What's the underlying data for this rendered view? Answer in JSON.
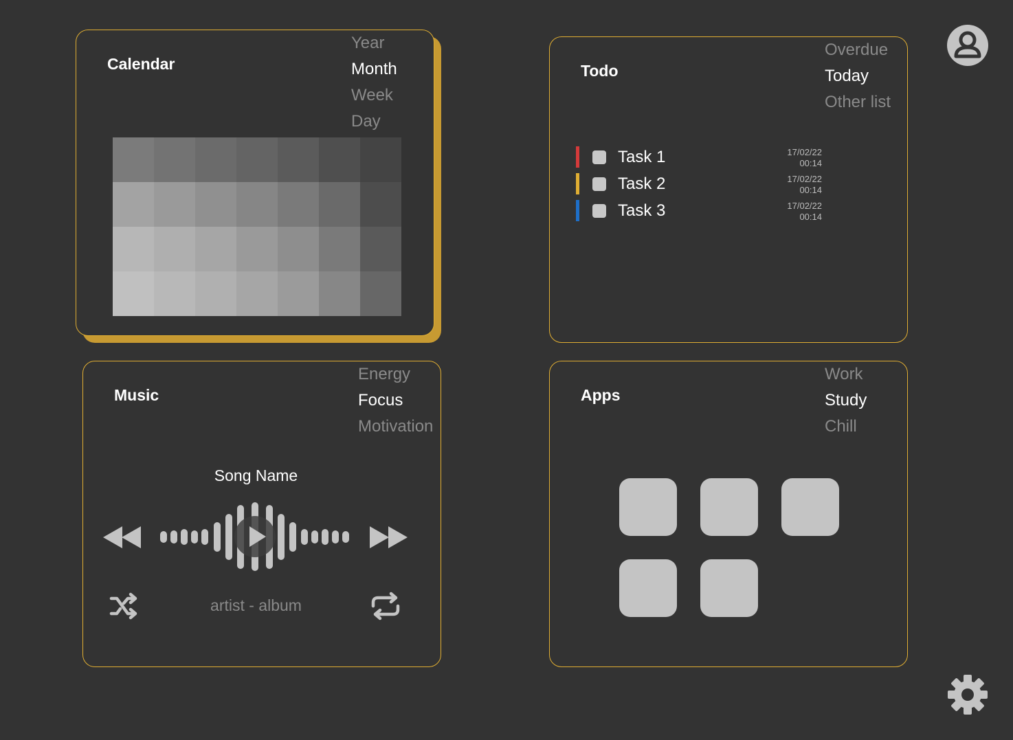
{
  "calendar": {
    "title": "Calendar",
    "views": [
      "Year",
      "Month",
      "Week",
      "Day"
    ],
    "active_view": "Month",
    "heatmap": [
      [
        "#7b7b7b",
        "#737373",
        "#6b6b6b",
        "#646464",
        "#5b5b5b",
        "#4f4f4f",
        "#444444"
      ],
      [
        "#a3a3a3",
        "#9a9a9a",
        "#909090",
        "#868686",
        "#7a7a7a",
        "#6a6a6a",
        "#4d4d4d"
      ],
      [
        "#b7b7b7",
        "#afafaf",
        "#a6a6a6",
        "#9a9a9a",
        "#8e8e8e",
        "#7a7a7a",
        "#5a5a5a"
      ],
      [
        "#c0c0c0",
        "#b8b8b8",
        "#b0b0b0",
        "#a6a6a6",
        "#9b9b9b",
        "#878787",
        "#676767"
      ]
    ]
  },
  "todo": {
    "title": "Todo",
    "lists": [
      "Overdue",
      "Today",
      "Other list"
    ],
    "active_list": "Today",
    "tasks": [
      {
        "label": "Task 1",
        "date": "17/02/22",
        "time": "00:14",
        "color": "#D53A3A"
      },
      {
        "label": "Task 2",
        "date": "17/02/22",
        "time": "00:14",
        "color": "#E0AE33"
      },
      {
        "label": "Task 3",
        "date": "17/02/22",
        "time": "00:14",
        "color": "#1E6FC8"
      }
    ]
  },
  "music": {
    "title": "Music",
    "playlists": [
      "Energy",
      "Focus",
      "Motivation"
    ],
    "active_playlist": "Focus",
    "song_name": "Song Name",
    "artist_album": "artist - album"
  },
  "apps": {
    "title": "Apps",
    "groups": [
      "Work",
      "Study",
      "Chill"
    ],
    "active_group": "Study",
    "tile_count": 5
  },
  "icons": {
    "profile": "user-avatar-icon",
    "settings": "gear-icon",
    "rewind": "rewind-icon",
    "forward": "fast-forward-icon",
    "play": "play-icon",
    "shuffle": "shuffle-icon",
    "repeat": "repeat-icon"
  },
  "colors": {
    "background": "#333333",
    "accent": "#E0AE33",
    "shadow": "#C79A32",
    "inactive_text": "#8a8a8a",
    "icon": "#c4c4c4"
  }
}
